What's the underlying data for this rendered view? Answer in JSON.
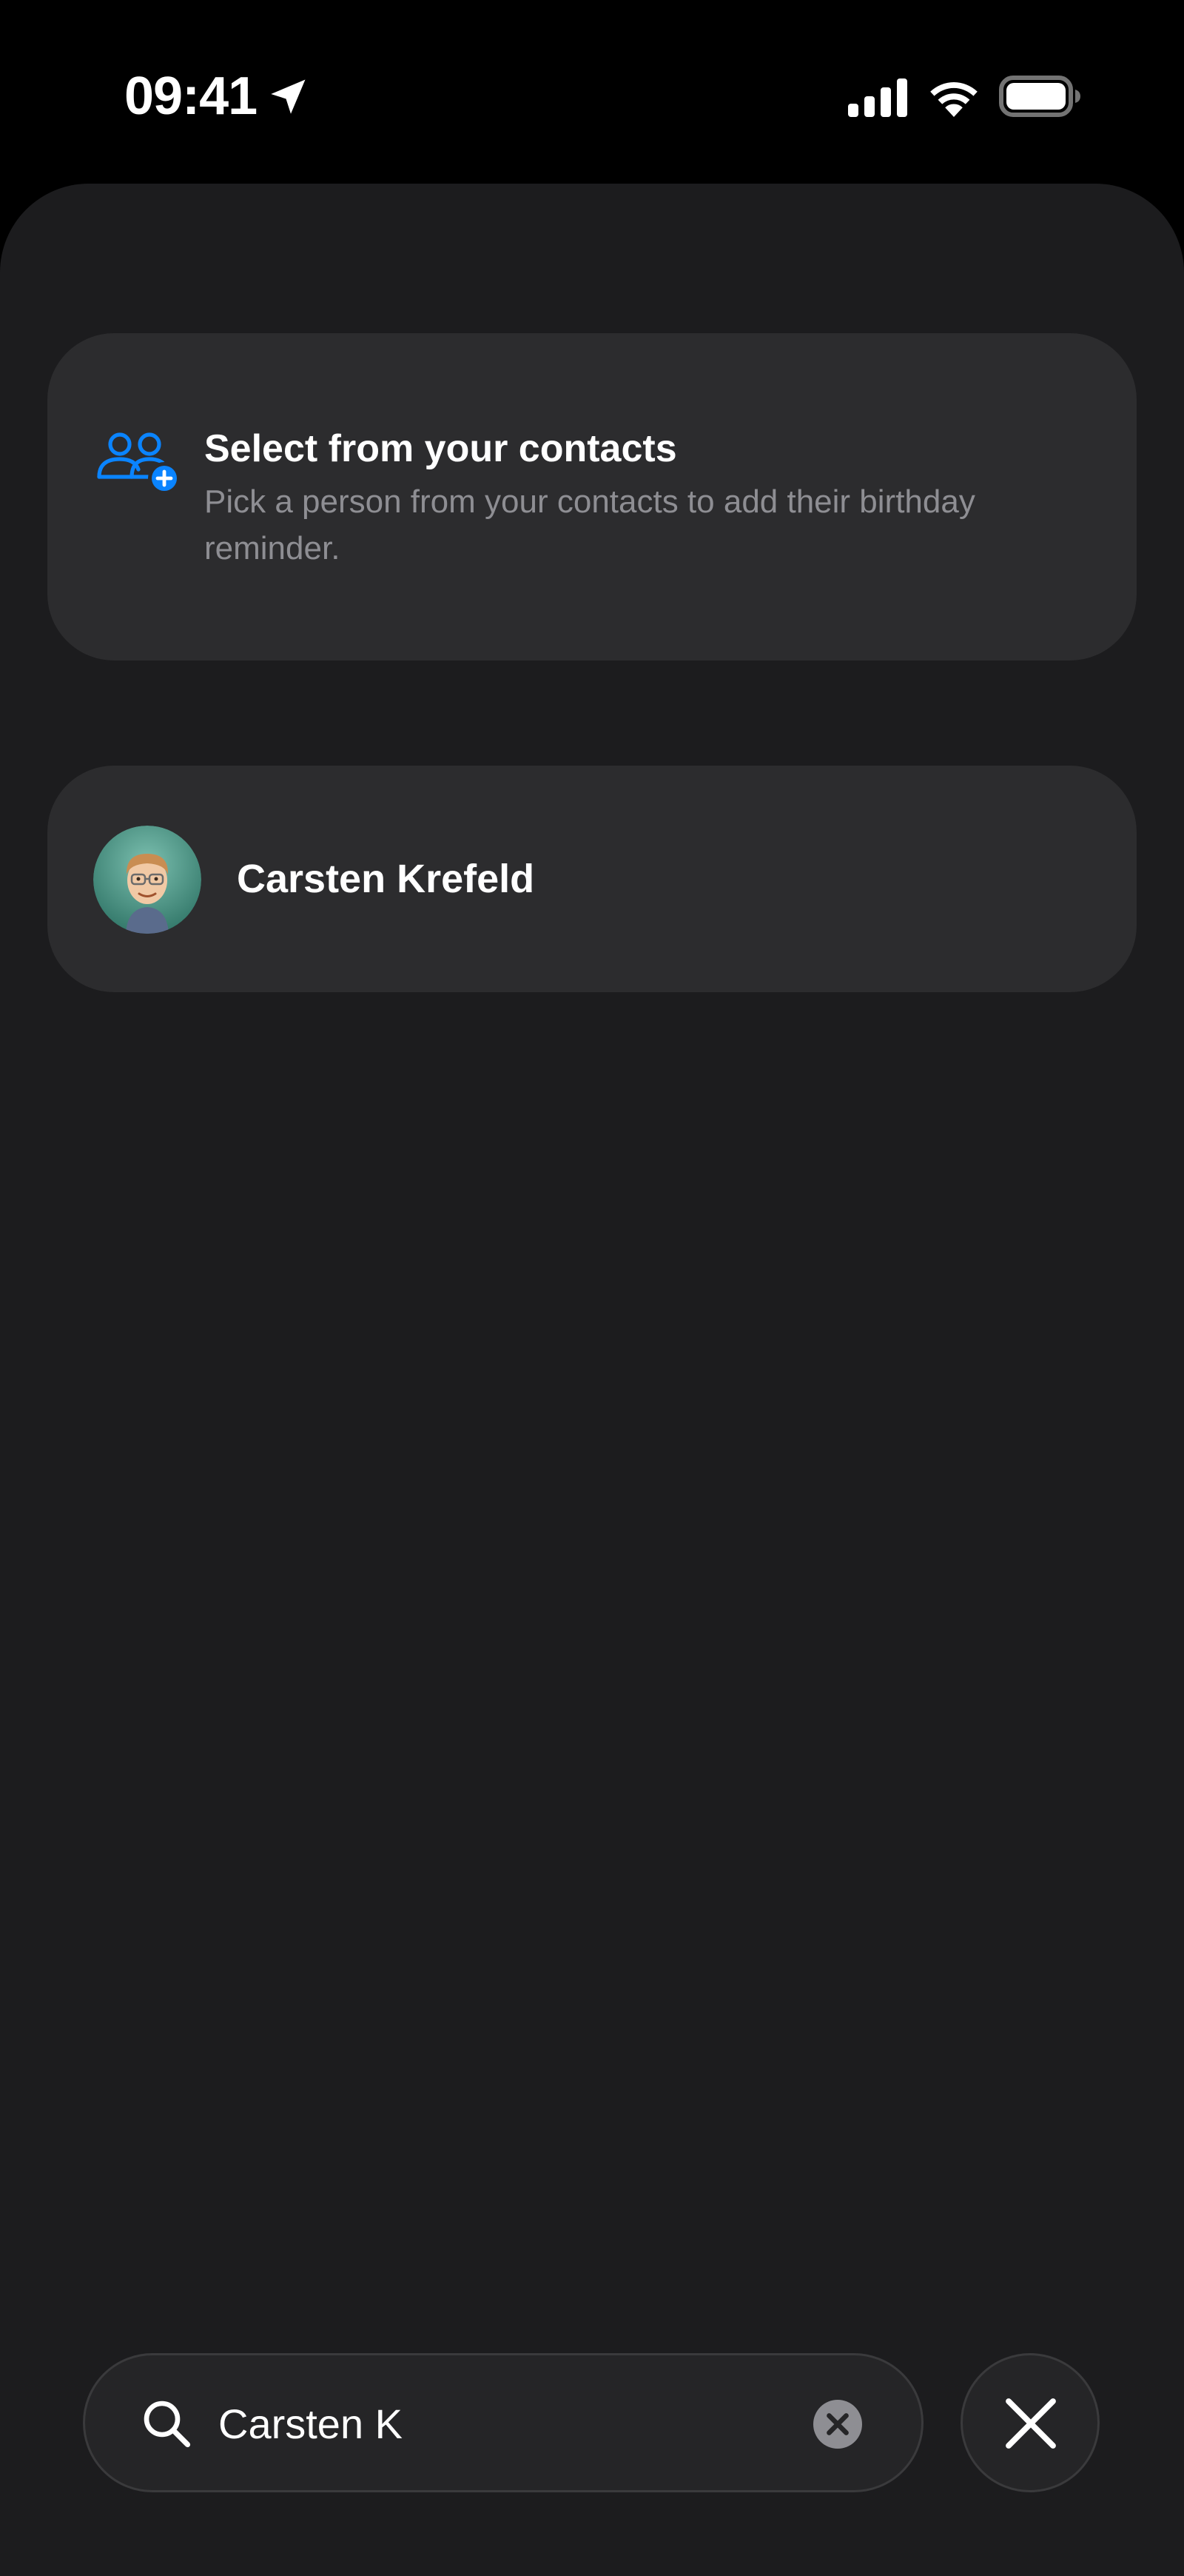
{
  "status_bar": {
    "time": "09:41",
    "icons": [
      "location-arrow-icon",
      "cellular-signal-icon",
      "wifi-icon",
      "battery-icon"
    ]
  },
  "contacts_card": {
    "icon": "contacts-add-icon",
    "title": "Select from your contacts",
    "description": "Pick a person from your contacts to add their birthday reminder."
  },
  "results": [
    {
      "name": "Carsten Krefeld",
      "avatar": "memoji-avatar"
    }
  ],
  "search": {
    "value": "Carsten K",
    "icons": [
      "search-icon",
      "clear-icon"
    ]
  },
  "close_button": {
    "icon": "close-icon"
  },
  "colors": {
    "accent": "#0a84ff",
    "background": "#1c1c1e",
    "card": "#2c2c2e",
    "secondary_text": "#8e8e93"
  }
}
